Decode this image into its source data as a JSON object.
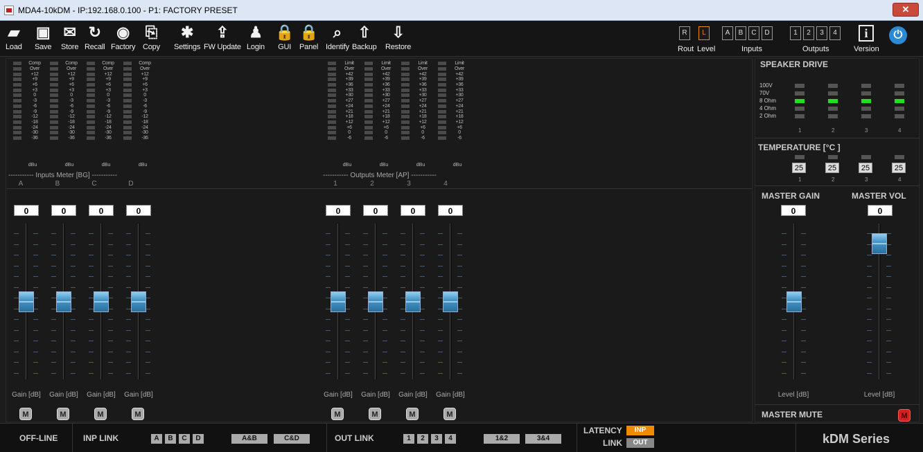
{
  "window": {
    "title": "MDA4-10kDM - IP:192.168.0.100 - P1: FACTORY PRESET",
    "close_label": "✕"
  },
  "toolbar": {
    "items": [
      {
        "label": "Load",
        "icon": "folder-open-icon",
        "glyph": "▰"
      },
      {
        "label": "Save",
        "icon": "floppy-disk-icon",
        "glyph": "▣"
      },
      {
        "label": "Store",
        "icon": "memory-chip-icon",
        "glyph": "✉"
      },
      {
        "label": "Recall",
        "icon": "refresh-icon",
        "glyph": "↻"
      },
      {
        "label": "Factory",
        "icon": "factory-reset-icon",
        "glyph": "◉"
      },
      {
        "label": "Copy",
        "icon": "copy-icon",
        "glyph": "⎘"
      },
      {
        "label": "Settings",
        "icon": "gear-icon",
        "glyph": "✱"
      },
      {
        "label": "FW Update",
        "icon": "firmware-update-icon",
        "glyph": "⇪"
      },
      {
        "label": "Login",
        "icon": "user-key-icon",
        "glyph": "♟"
      },
      {
        "label": "GUI",
        "icon": "lock-icon",
        "glyph": "🔒"
      },
      {
        "label": "Panel",
        "icon": "lock-icon",
        "glyph": "🔒"
      },
      {
        "label": "Identify",
        "icon": "identify-icon",
        "glyph": "⌕"
      },
      {
        "label": "Backup",
        "icon": "backup-icon",
        "glyph": "⇧"
      },
      {
        "label": "Restore",
        "icon": "restore-icon",
        "glyph": "⇩"
      }
    ],
    "rout_label": "Rout",
    "level_label": "Level",
    "r_btn": "R",
    "l_btn": "L",
    "inputs_label": "Inputs",
    "inputs": [
      "A",
      "B",
      "C",
      "D"
    ],
    "outputs_label": "Outputs",
    "outputs": [
      "1",
      "2",
      "3",
      "4"
    ],
    "version_label": "Version",
    "info_glyph": "i",
    "power_glyph": "⏻"
  },
  "inputs_meter": {
    "title": "----------- Inputs Meter [BG] -----------",
    "scale": [
      "Comp",
      "Over",
      "+12",
      "+9",
      "+6",
      "+3",
      "0",
      "-3",
      "-6",
      "-9",
      "-12",
      "-18",
      "-24",
      "-30",
      "-36"
    ],
    "unit": "dBu",
    "channels": [
      "A",
      "B",
      "C",
      "D"
    ]
  },
  "outputs_meter": {
    "title": "----------- Outputs Meter [AP] -----------",
    "scale": [
      "Limit",
      "Over",
      "+42",
      "+39",
      "+36",
      "+33",
      "+30",
      "+27",
      "+24",
      "+21",
      "+18",
      "+12",
      "+6",
      "0",
      "-6"
    ],
    "unit": "dBu",
    "channels": [
      "1",
      "2",
      "3",
      "4"
    ]
  },
  "input_gains": [
    "0",
    "0",
    "0",
    "0"
  ],
  "output_gains": [
    "0",
    "0",
    "0",
    "0"
  ],
  "gain_label": "Gain [dB]",
  "mute_label": "M",
  "speaker_drive": {
    "title": "SPEAKER DRIVE",
    "rows": [
      "100V",
      "70V",
      "8 Ohm",
      "4 Ohm",
      "2 Ohm"
    ],
    "active_row": "8 Ohm",
    "channels": [
      "1",
      "2",
      "3",
      "4"
    ]
  },
  "temperature": {
    "title": "TEMPERATURE [°C ]",
    "values": [
      "25",
      "25",
      "25",
      "25"
    ],
    "channels": [
      "1",
      "2",
      "3",
      "4"
    ]
  },
  "master_gain": {
    "title": "MASTER GAIN",
    "value": "0",
    "label": "Level [dB]",
    "fader_level": 0.5
  },
  "master_vol": {
    "title": "MASTER VOL",
    "value": "0",
    "label": "Level [dB]",
    "fader_level": 0.93
  },
  "master_mute": {
    "title": "MASTER MUTE",
    "button": "M"
  },
  "fader_level": 0.5,
  "status": {
    "offline": "OFF-LINE",
    "inp_link": "INP LINK",
    "inp_buttons": [
      "A",
      "B",
      "C",
      "D",
      "A&B",
      "C&D"
    ],
    "out_link": "OUT LINK",
    "out_buttons": [
      "1",
      "2",
      "3",
      "4",
      "1&2",
      "3&4"
    ],
    "latency": "LATENCY",
    "link": "LINK",
    "inp": "INP",
    "out": "OUT",
    "series": "kDM Series"
  },
  "colors": {
    "accent": "#f08a00",
    "active_green": "#20e020",
    "mute_red": "#d42020",
    "power_blue": "#2a8ad4"
  }
}
